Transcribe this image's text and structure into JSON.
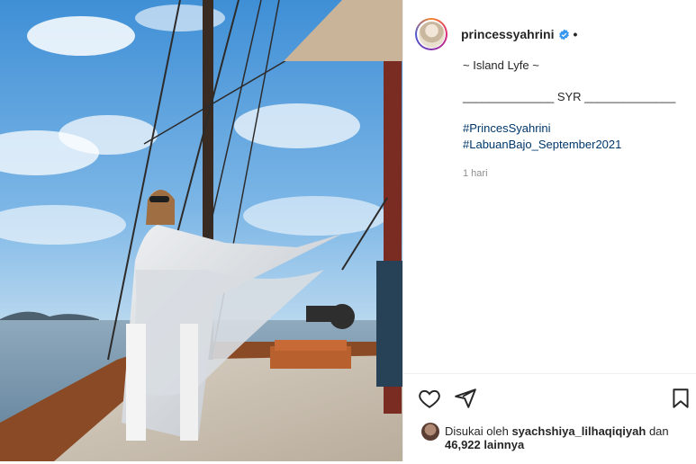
{
  "post": {
    "username": "princessyahrini",
    "caption_lines": [
      "~ Island Lyfe ~",
      "______________ SYR ______________"
    ],
    "hashtags": [
      "#PrincesSyahrini",
      "#LabuanBajo_September2021"
    ],
    "time": "1 hari"
  },
  "likes": {
    "prefix": "Disukai oleh",
    "user": "syachshiya_lilhaqiqiyah",
    "and": "dan",
    "count": "46,922",
    "others": "lainnya"
  },
  "colors": {
    "verified": "#3897f0",
    "hashtag": "#00376b",
    "muted": "#8e8e8e"
  },
  "icons": [
    "heart-icon",
    "share-icon",
    "bookmark-icon",
    "verified-badge-icon"
  ]
}
